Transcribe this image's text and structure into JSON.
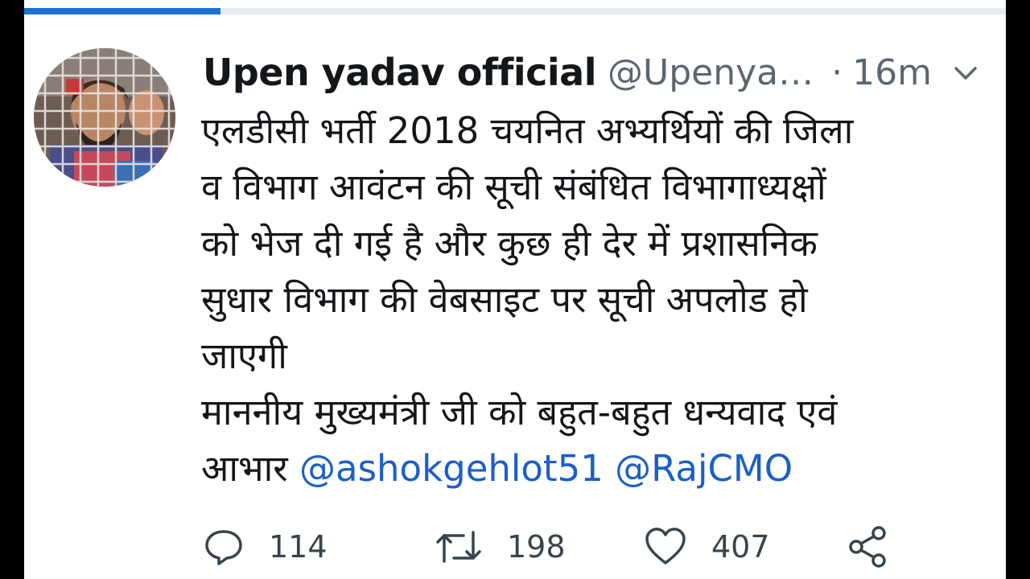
{
  "progress": {
    "fraction": 0.2,
    "color": "#1d6fd1"
  },
  "tweet": {
    "author": {
      "display_name": "Upen yadav official",
      "handle": "@Upenya…",
      "avatar": "profile-photo"
    },
    "separator": "·",
    "timestamp": "16m",
    "text_lines": [
      "एलडीसी भर्ती 2018 चयनित अभ्यर्थियों की जिला",
      "व विभाग आवंटन की सूची संबंधित विभागाध्यक्षों",
      "को भेज दी गई है और कुछ ही देर में प्रशासनिक",
      "सुधार विभाग की वेबसाइट पर सूची अपलोड हो",
      "जाएगी",
      "माननीय मुख्यमंत्री जी को बहुत-बहुत धन्यवाद एवं"
    ],
    "last_line_prefix": "आभार ",
    "mentions": [
      "@ashokgehlot51",
      "@RajCMO"
    ],
    "actions": {
      "reply_count": "114",
      "retweet_count": "198",
      "like_count": "407"
    },
    "icons": {
      "reply": "reply-icon",
      "retweet": "retweet-icon",
      "like": "heart-icon",
      "share": "share-icon",
      "menu": "chevron-down-icon"
    },
    "colors": {
      "text": "#14171a",
      "secondary": "#5b6670",
      "link": "#1b5fc8"
    }
  }
}
